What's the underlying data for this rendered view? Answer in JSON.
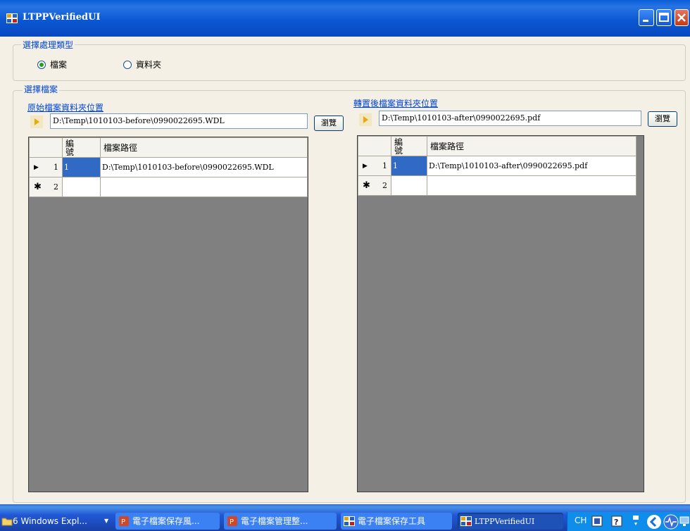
{
  "window": {
    "title": "LTPPVerifiedUI"
  },
  "type_group": {
    "label": "選擇處理類型",
    "options": [
      {
        "label": "檔案",
        "selected": true
      },
      {
        "label": "資料夾",
        "selected": false
      }
    ]
  },
  "file_group": {
    "label": "選擇檔案",
    "source": {
      "label": "原始檔案資料夾位置",
      "path": "D:\\Temp\\1010103-before\\0990022695.WDL",
      "browse": "瀏覽",
      "grid": {
        "headers": [
          "編號",
          "檔案路徑"
        ],
        "rows": [
          {
            "row_no": "1",
            "marker": "▶",
            "id": "1",
            "path": "D:\\Temp\\1010103-before\\0990022695.WDL"
          },
          {
            "row_no": "2",
            "marker": "✱",
            "id": "",
            "path": ""
          }
        ]
      }
    },
    "target": {
      "label": "轉置後檔案資料夾位置",
      "path": "D:\\Temp\\1010103-after\\0990022695.pdf",
      "browse": "瀏覽",
      "grid": {
        "headers": [
          "編號",
          "檔案路徑"
        ],
        "rows": [
          {
            "row_no": "1",
            "marker": "▶",
            "id": "1",
            "path": "D:\\Temp\\1010103-after\\0990022695.pdf"
          },
          {
            "row_no": "2",
            "marker": "✱",
            "id": "",
            "path": ""
          }
        ]
      }
    }
  },
  "taskbar": {
    "items": [
      {
        "label": "6 Windows Expl...",
        "icon": "folder-icon"
      },
      {
        "label": "電子檔案保存風...",
        "icon": "ppt-icon"
      },
      {
        "label": "電子檔案管理整...",
        "icon": "ppt-icon"
      },
      {
        "label": "電子檔案保存工具",
        "icon": "app-icon"
      },
      {
        "label": "LTPPVerifiedUI",
        "icon": "app-icon",
        "active": true
      }
    ],
    "tray": {
      "lang": "CH"
    }
  }
}
